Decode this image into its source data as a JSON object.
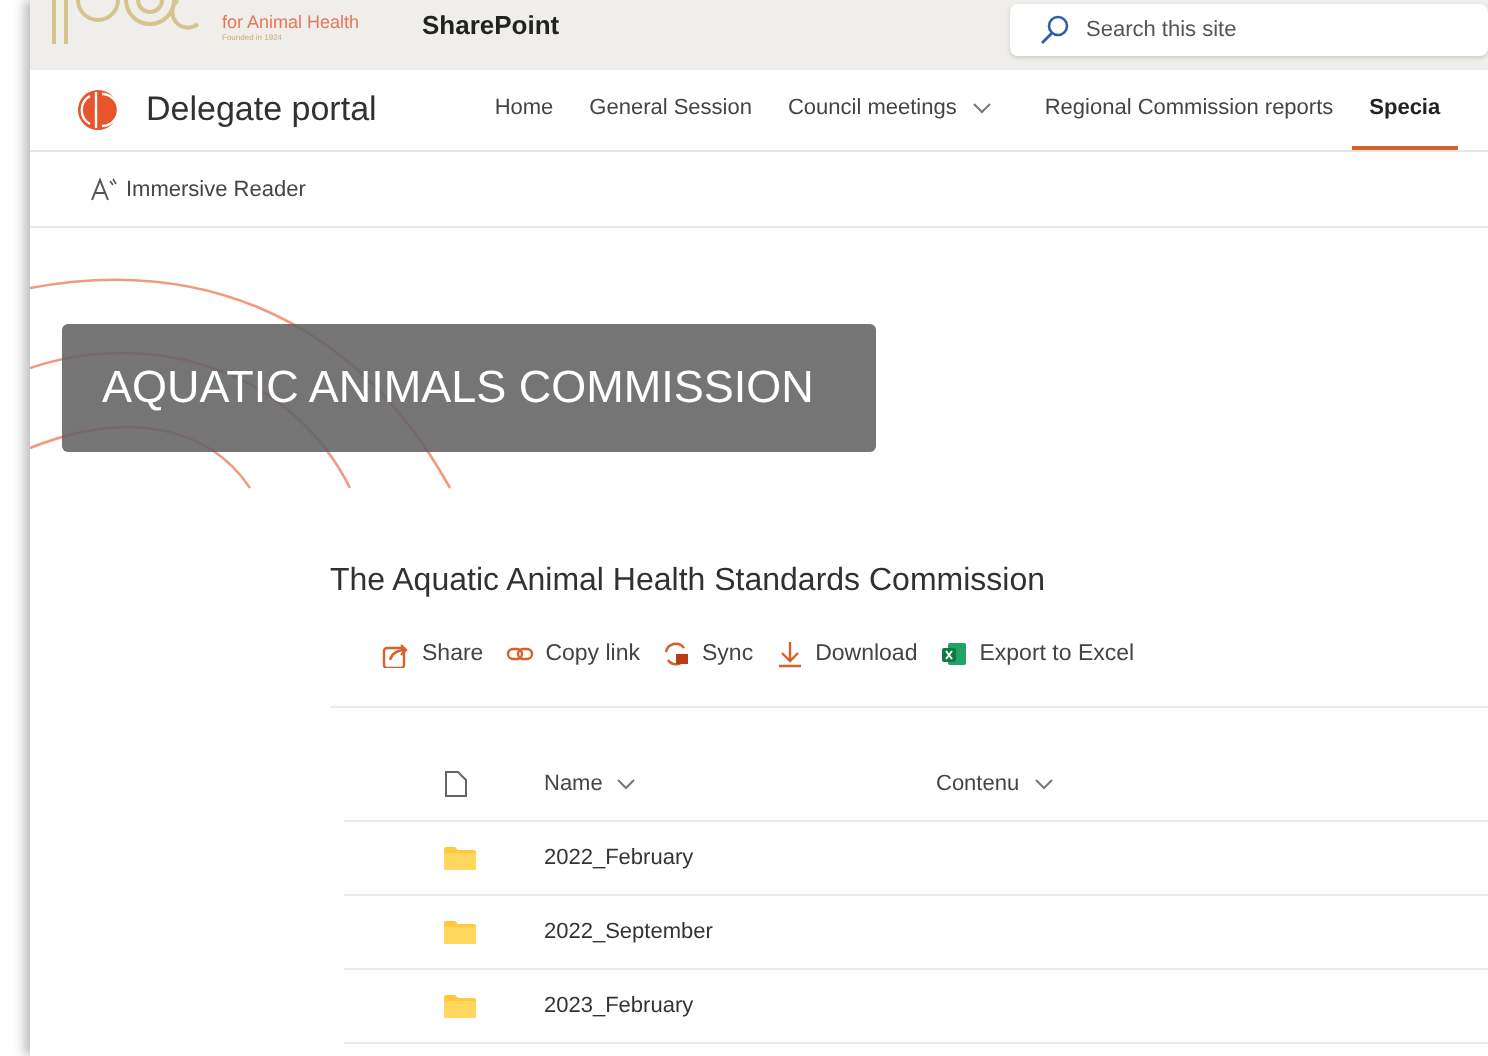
{
  "org_logo": {
    "name": "for Animal Health",
    "tagline": "Founded in 1924"
  },
  "suite_bar": {
    "app": "SharePoint",
    "search": {
      "placeholder": "Search this site"
    }
  },
  "site": {
    "title": "Delegate portal"
  },
  "nav": [
    {
      "label": "Home",
      "selected": false,
      "dropdown": false
    },
    {
      "label": "General Session",
      "selected": false,
      "dropdown": false
    },
    {
      "label": "Council meetings",
      "selected": false,
      "dropdown": true
    },
    {
      "label": "Regional Commission reports",
      "selected": false,
      "dropdown": false
    },
    {
      "label": "Specia",
      "selected": true,
      "dropdown": false
    }
  ],
  "command_bar": {
    "label": "Immersive Reader"
  },
  "banner": {
    "title": "AQUATIC ANIMALS COMMISSION"
  },
  "library": {
    "title": "The Aquatic Animal Health Standards Commission",
    "actions": [
      {
        "kind": "share",
        "label": "Share"
      },
      {
        "kind": "link",
        "label": "Copy link"
      },
      {
        "kind": "sync",
        "label": "Sync"
      },
      {
        "kind": "download",
        "label": "Download"
      },
      {
        "kind": "excel",
        "label": "Export to Excel"
      }
    ],
    "columns": [
      "Name",
      "Contenu"
    ],
    "rows": [
      {
        "name": "2022_February"
      },
      {
        "name": "2022_September"
      },
      {
        "name": "2023_February"
      }
    ]
  }
}
